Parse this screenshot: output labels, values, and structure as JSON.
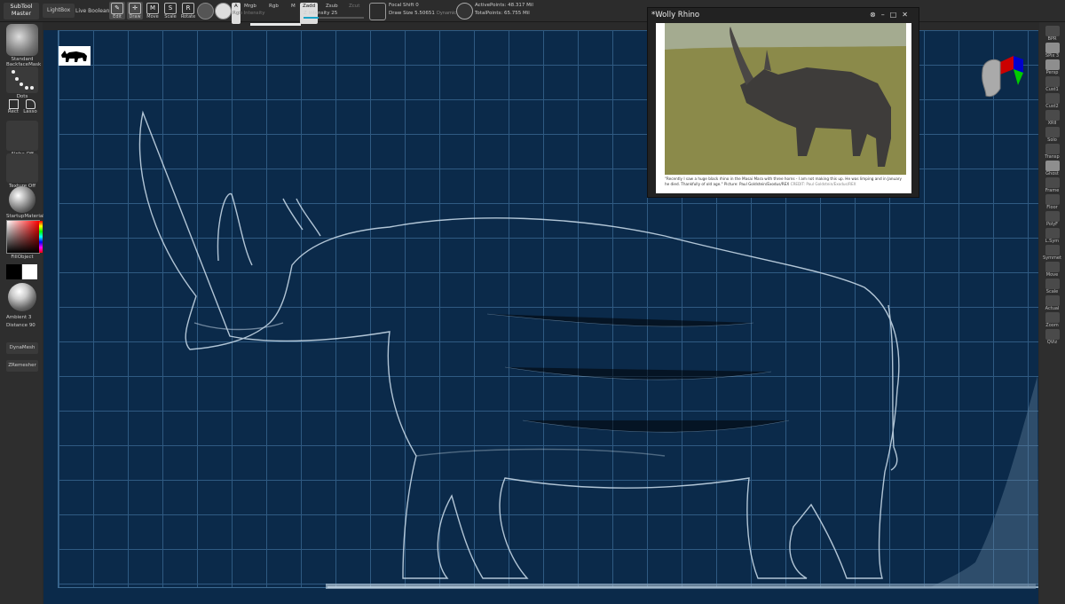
{
  "topbar": {
    "subtool_master": "SubTool Master",
    "lightbox": "LightBox",
    "live_boolean": "Live Boolean",
    "tools": [
      {
        "label": "Edit"
      },
      {
        "label": "Draw"
      },
      {
        "label": "Move"
      },
      {
        "label": "Scale"
      },
      {
        "label": "Rotate"
      }
    ],
    "modes": {
      "a": "A",
      "mrgb": "Mrgb",
      "rgb": "Rgb",
      "m": "M",
      "zadd": "Zadd",
      "zsub": "Zsub",
      "zcut": "Zcut"
    },
    "rgb_intensity_label": "Rgb Intensity",
    "z_intensity_label": "Z Intensity",
    "z_intensity_value": "25",
    "focal_shift_label": "Focal Shift",
    "focal_shift_value": "0",
    "draw_size_label": "Draw Size",
    "draw_size_value": "5.50651",
    "dynamic_label": "Dynamic",
    "active_points_label": "ActivePoints:",
    "active_points_value": "48.317 Mil",
    "total_points_label": "TotalPoints:",
    "total_points_value": "65.755 Mil",
    "z_intensity_level": 0.25
  },
  "leftbar": {
    "standard": "Standard",
    "backface_mask": "BackfaceMask",
    "dots": "Dots",
    "rect": "Rect",
    "lasso": "Lasso",
    "alpha_off": "Alpha Off",
    "texture_off": "Texture Off",
    "startup_material": "StartupMaterial",
    "fill_object": "FillObject",
    "ambient_label": "Ambient",
    "ambient_value": "3",
    "distance_label": "Distance",
    "distance_value": "90",
    "dynamesh": "DynaMesh",
    "zremesher": "ZRemesher"
  },
  "rightbar": {
    "items": [
      "BPR",
      "SPix 3",
      "Persp",
      "Cust1",
      "Cust2",
      "XRII",
      "Solo",
      "Transp",
      "Ghost",
      "Frame",
      "Floor",
      "PolyF",
      "L.Sym",
      "Symmet",
      "Move",
      "Scale",
      "Actual",
      "Zoom",
      "QViz"
    ]
  },
  "reference_window": {
    "title": "*Wolly Rhino",
    "caption": "\"Recently I saw a huge black rhino in the Masai Mara with three horns - I am not making this up. He was limping and in January he died. Thankfully of old age.\" Picture: Paul Goldstein/Exodus/REX",
    "credit": "CREDIT: Paul Goldstein/Exodus/REX"
  },
  "colors": {
    "canvas_bg": "#0b2a4a",
    "grid_line": "#2f5a82",
    "accent": "#19a3c7",
    "sketch_line": "#cfe0ee"
  }
}
